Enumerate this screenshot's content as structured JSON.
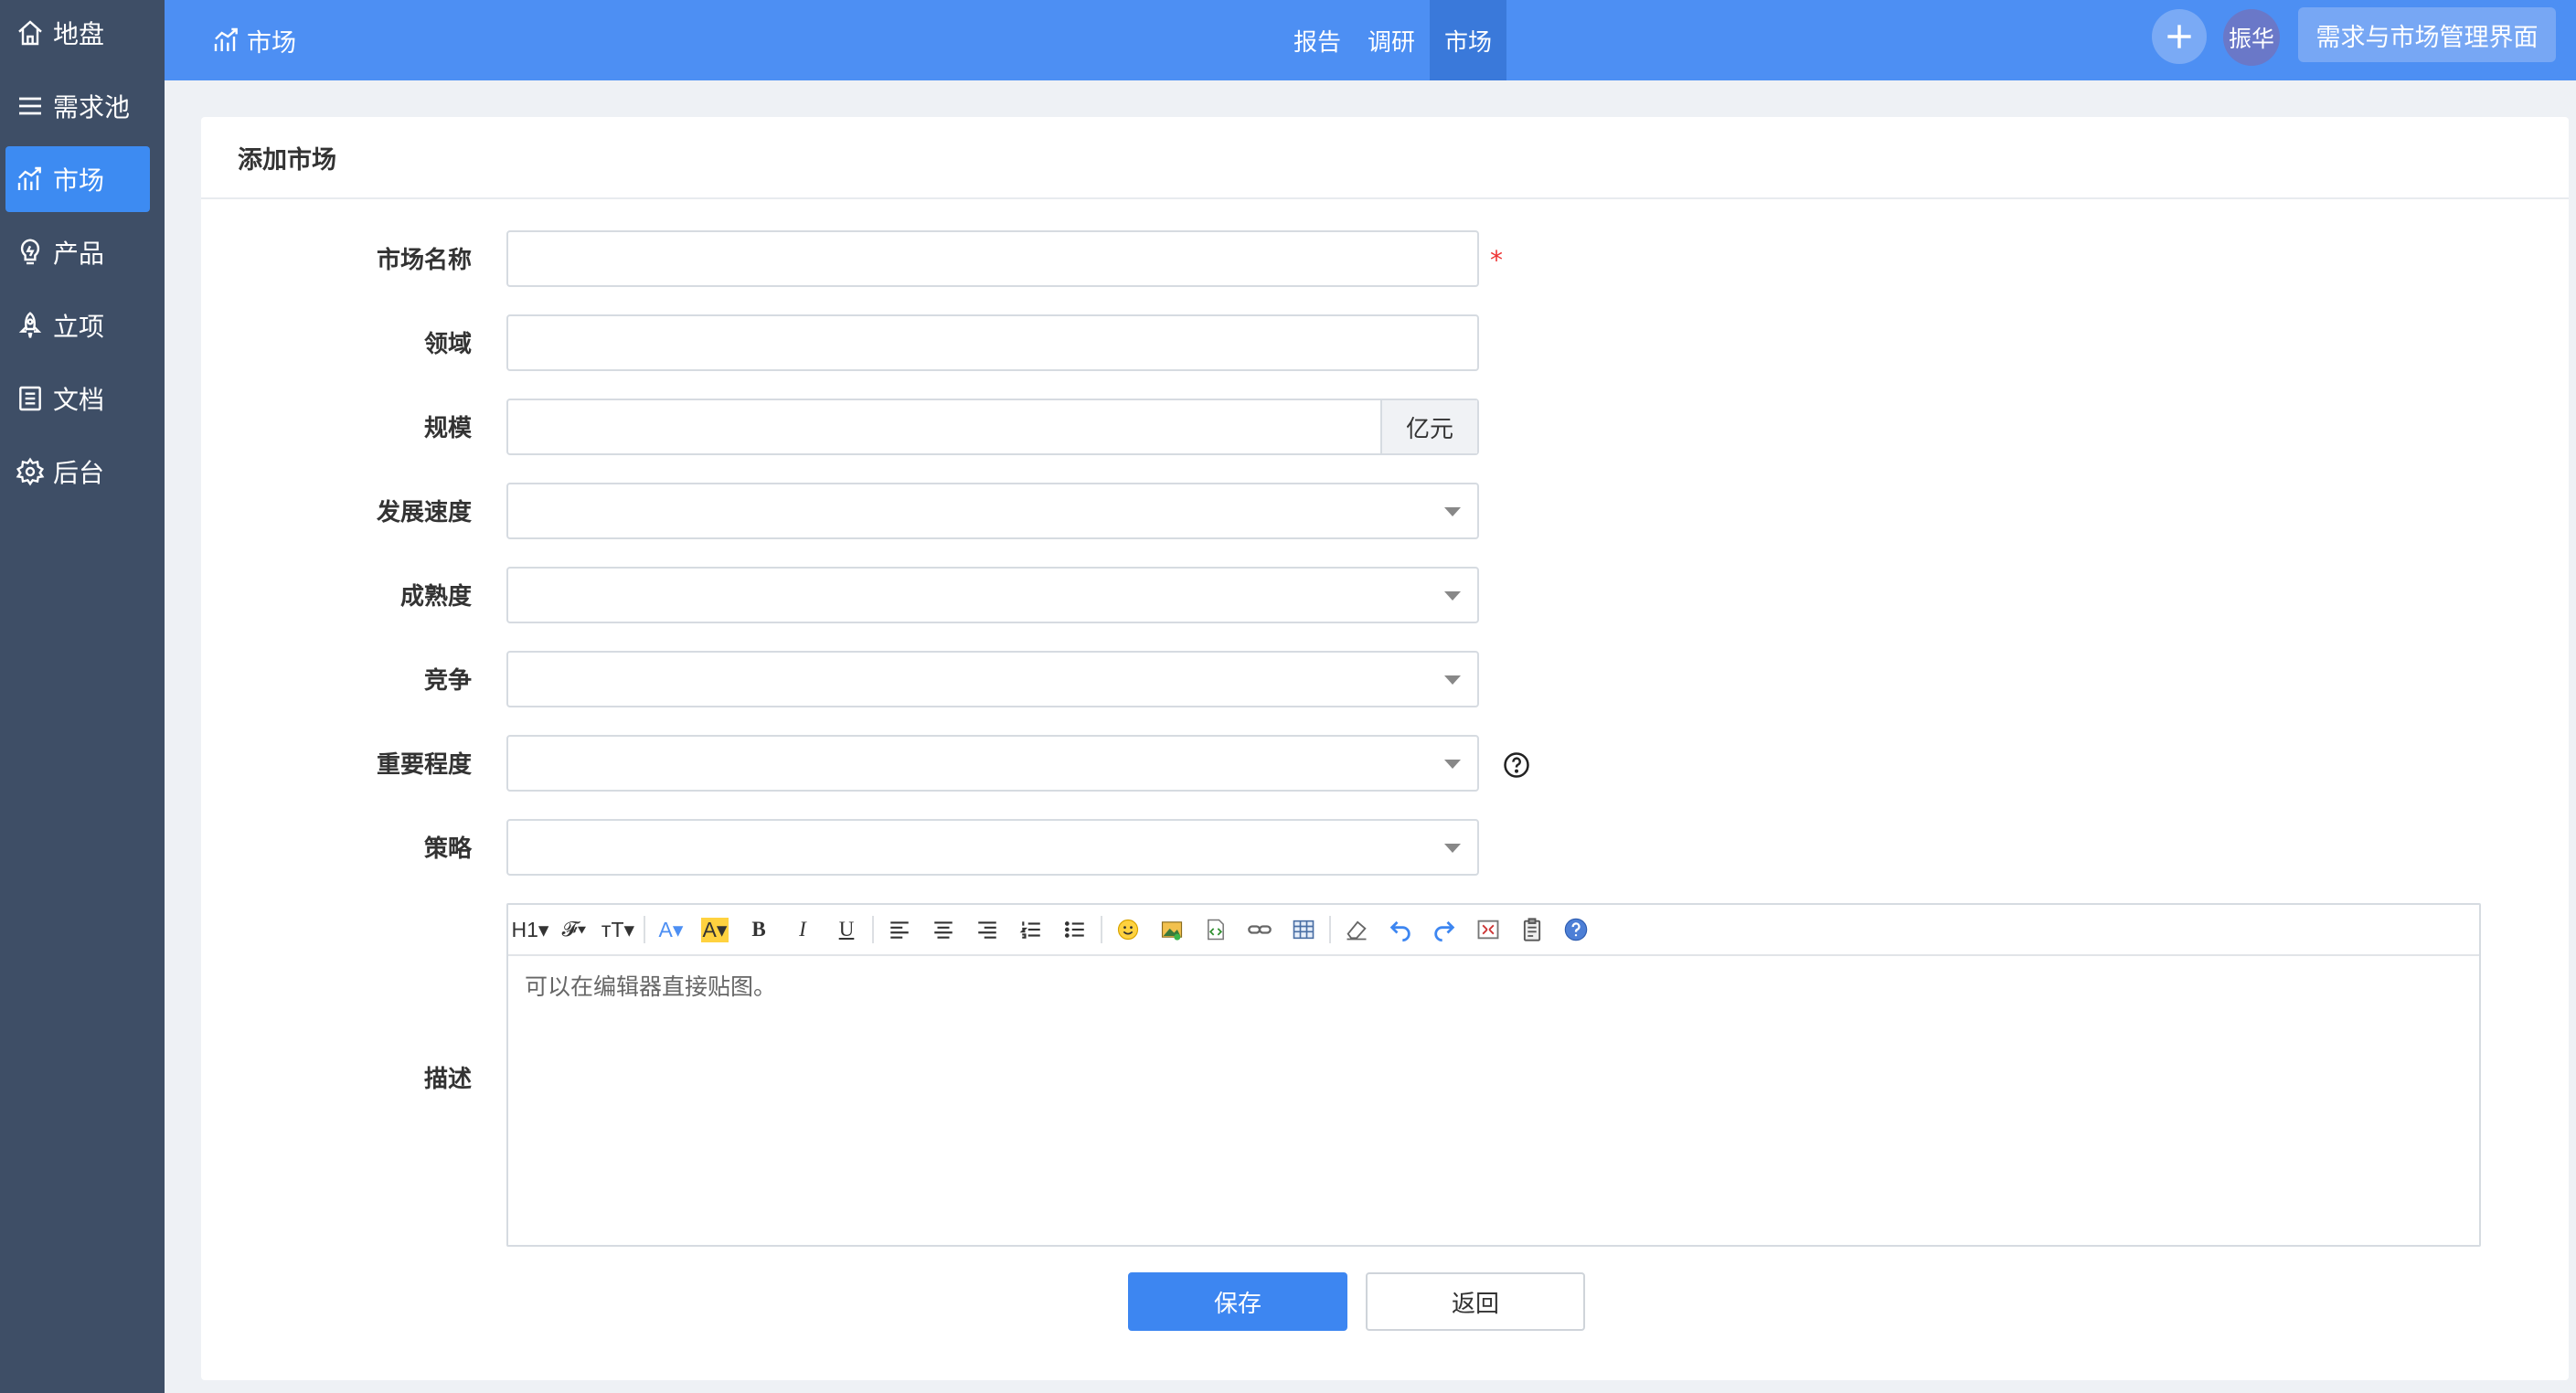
{
  "sidebar": {
    "items": [
      {
        "label": "地盘",
        "icon": "home-icon"
      },
      {
        "label": "需求池",
        "icon": "list-icon"
      },
      {
        "label": "市场",
        "icon": "market-chart-icon",
        "active": true
      },
      {
        "label": "产品",
        "icon": "lightbulb-icon"
      },
      {
        "label": "立项",
        "icon": "rocket-icon"
      },
      {
        "label": "文档",
        "icon": "document-icon"
      },
      {
        "label": "后台",
        "icon": "gear-icon"
      }
    ]
  },
  "header": {
    "title": "市场",
    "tabs": [
      {
        "label": "报告"
      },
      {
        "label": "调研"
      },
      {
        "label": "市场",
        "active": true
      }
    ],
    "avatar_name": "振华",
    "interface_label": "需求与市场管理界面",
    "accent": "#4d8ff3"
  },
  "form": {
    "title": "添加市场",
    "fields": {
      "name": {
        "label": "市场名称",
        "value": "",
        "required": "*"
      },
      "domain": {
        "label": "领域",
        "value": ""
      },
      "scale": {
        "label": "规模",
        "value": "",
        "unit": "亿元"
      },
      "speed": {
        "label": "发展速度",
        "value": ""
      },
      "maturity": {
        "label": "成熟度",
        "value": ""
      },
      "competition": {
        "label": "竞争",
        "value": ""
      },
      "importance": {
        "label": "重要程度",
        "value": ""
      },
      "strategy": {
        "label": "策略",
        "value": ""
      }
    },
    "description": {
      "label": "描述",
      "placeholder": "可以在编辑器直接贴图。",
      "toolbar": [
        "H1▾",
        "𝓕▾",
        "тT▾",
        "A▾",
        "A▾",
        "B",
        "I",
        "U"
      ]
    },
    "save_label": "保存",
    "back_label": "返回"
  }
}
